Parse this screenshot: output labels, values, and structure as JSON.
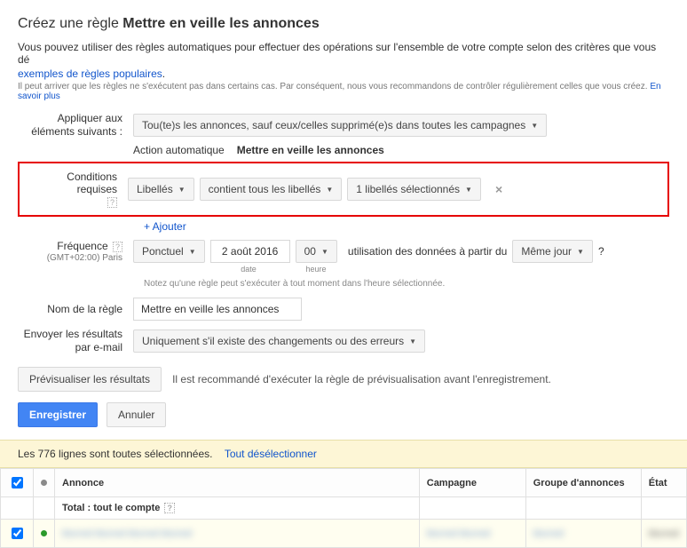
{
  "title_prefix": "Créez une règle",
  "title_bold": "Mettre en veille les annonces",
  "intro_text": "Vous pouvez utiliser des règles automatiques pour effectuer des opérations sur l'ensemble de votre compte selon des critères que vous dé",
  "intro_link": "exemples de règles populaires",
  "sub_text": "Il peut arriver que les règles ne s'exécutent pas dans certains cas. Par conséquent, nous vous recommandons de contrôler régulièrement celles que vous créez.",
  "sub_link": "En savoir plus",
  "apply": {
    "label_l1": "Appliquer aux",
    "label_l2": "éléments suivants :",
    "value": "Tou(te)s les annonces, sauf ceux/celles supprimé(e)s dans toutes les campagnes"
  },
  "action": {
    "label": "Action automatique",
    "value": "Mettre en veille les annonces"
  },
  "conditions": {
    "label": "Conditions requises",
    "field": "Libellés",
    "op": "contient tous les libellés",
    "sel": "1 libellés sélectionnés",
    "add": "+ Ajouter"
  },
  "freq": {
    "label": "Fréquence",
    "tz": "(GMT+02:00) Paris",
    "mode": "Ponctuel",
    "date": "2 août 2016",
    "hour": "00",
    "usage": "utilisation des données à partir du",
    "same": "Même jour",
    "date_l": "date",
    "hour_l": "heure",
    "note": "Notez qu'une règle peut s'exécuter à tout moment dans l'heure sélectionnée."
  },
  "name": {
    "label": "Nom de la règle",
    "value": "Mettre en veille les annonces"
  },
  "email": {
    "label_l1": "Envoyer les résultats",
    "label_l2": "par e-mail",
    "value": "Uniquement s'il existe des changements ou des erreurs"
  },
  "preview_btn": "Prévisualiser les résultats",
  "preview_reco": "Il est recommandé d'exécuter la règle de prévisualisation avant l'enregistrement.",
  "save": "Enregistrer",
  "cancel": "Annuler",
  "yellow": {
    "text": "Les 776 lignes sont toutes sélectionnées.",
    "link": "Tout désélectionner"
  },
  "table": {
    "h_annonce": "Annonce",
    "h_campagne": "Campagne",
    "h_groupe": "Groupe d'annonces",
    "h_etat": "État",
    "total": "Total : tout le compte",
    "row1_annonce": "blurred blurred blurred blurred",
    "row1_campagne": "blurred blurred",
    "row1_groupe": "blurred",
    "row1_etat": "blurred"
  }
}
